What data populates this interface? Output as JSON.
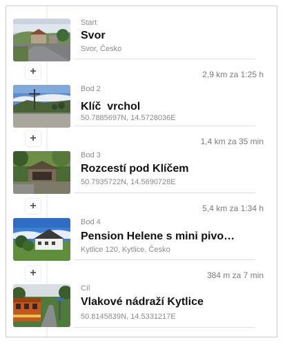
{
  "route": {
    "points": [
      {
        "kind": "Start",
        "name": "Svor",
        "address": "Svor, Česko",
        "thumb": "village-road-photo"
      },
      {
        "kind": "Bod 2",
        "name": "Klíč  vrchol",
        "address": "50.7885697N, 14.5728036E",
        "thumb": "summit-cross-photo"
      },
      {
        "kind": "Bod 3",
        "name": "Rozcestí pod Klíčem",
        "address": "50.7935722N, 14.5690728E",
        "thumb": "forest-shelter-photo"
      },
      {
        "kind": "Bod 4",
        "name": "Pension Helene s mini pivo…",
        "address": "Kytlice 120, Kytlice, Česko",
        "thumb": "guesthouse-photo"
      },
      {
        "kind": "Cíl",
        "name": "Vlakové nádraží Kytlice",
        "address": "50.8145839N, 14.5331217E",
        "thumb": "train-station-photo"
      }
    ],
    "segments": [
      {
        "add_label": "+",
        "distance": "2,9 km za 1:25 h"
      },
      {
        "add_label": "+",
        "distance": "1,4 km za 35 min"
      },
      {
        "add_label": "+",
        "distance": "5,4 km za 1:34 h"
      },
      {
        "add_label": "+",
        "distance": "384 m za 7 min"
      }
    ]
  }
}
